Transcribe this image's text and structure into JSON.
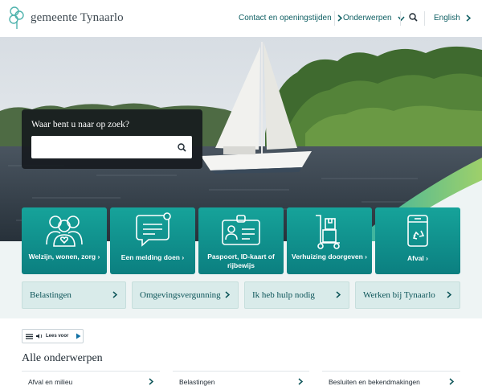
{
  "brand": {
    "name": "gemeente Tynaarlo",
    "accent": "#0f8c88",
    "dark_teal": "#0d5559"
  },
  "nav": {
    "contact": "Contact en openingstijden",
    "subjects": "Onderwerpen",
    "language": "English"
  },
  "search": {
    "label": "Waar bent u naar op zoek?",
    "value": "",
    "placeholder": ""
  },
  "tiles": [
    {
      "label": "Welzijn, wonen, zorg",
      "icon": "people-icon"
    },
    {
      "label": "Een melding doen",
      "icon": "chat-icon"
    },
    {
      "label": "Paspoort, ID-kaart of rijbewijs",
      "icon": "id-card-icon"
    },
    {
      "label": "Verhuizing doorgeven",
      "icon": "moving-boxes-icon"
    },
    {
      "label": "Afval",
      "icon": "recycle-bin-icon"
    }
  ],
  "quick_links": [
    {
      "label": "Belastingen"
    },
    {
      "label": "Omgevingsvergunning"
    },
    {
      "label": "Ik heb hulp nodig"
    },
    {
      "label": "Werken bij Tynaarlo"
    }
  ],
  "read_aloud": {
    "label": "Lees voor"
  },
  "all_subjects": {
    "title": "Alle onderwerpen",
    "items": [
      {
        "label": "Afval en milieu"
      },
      {
        "label": "Belastingen"
      },
      {
        "label": "Besluiten en bekendmakingen"
      }
    ]
  }
}
